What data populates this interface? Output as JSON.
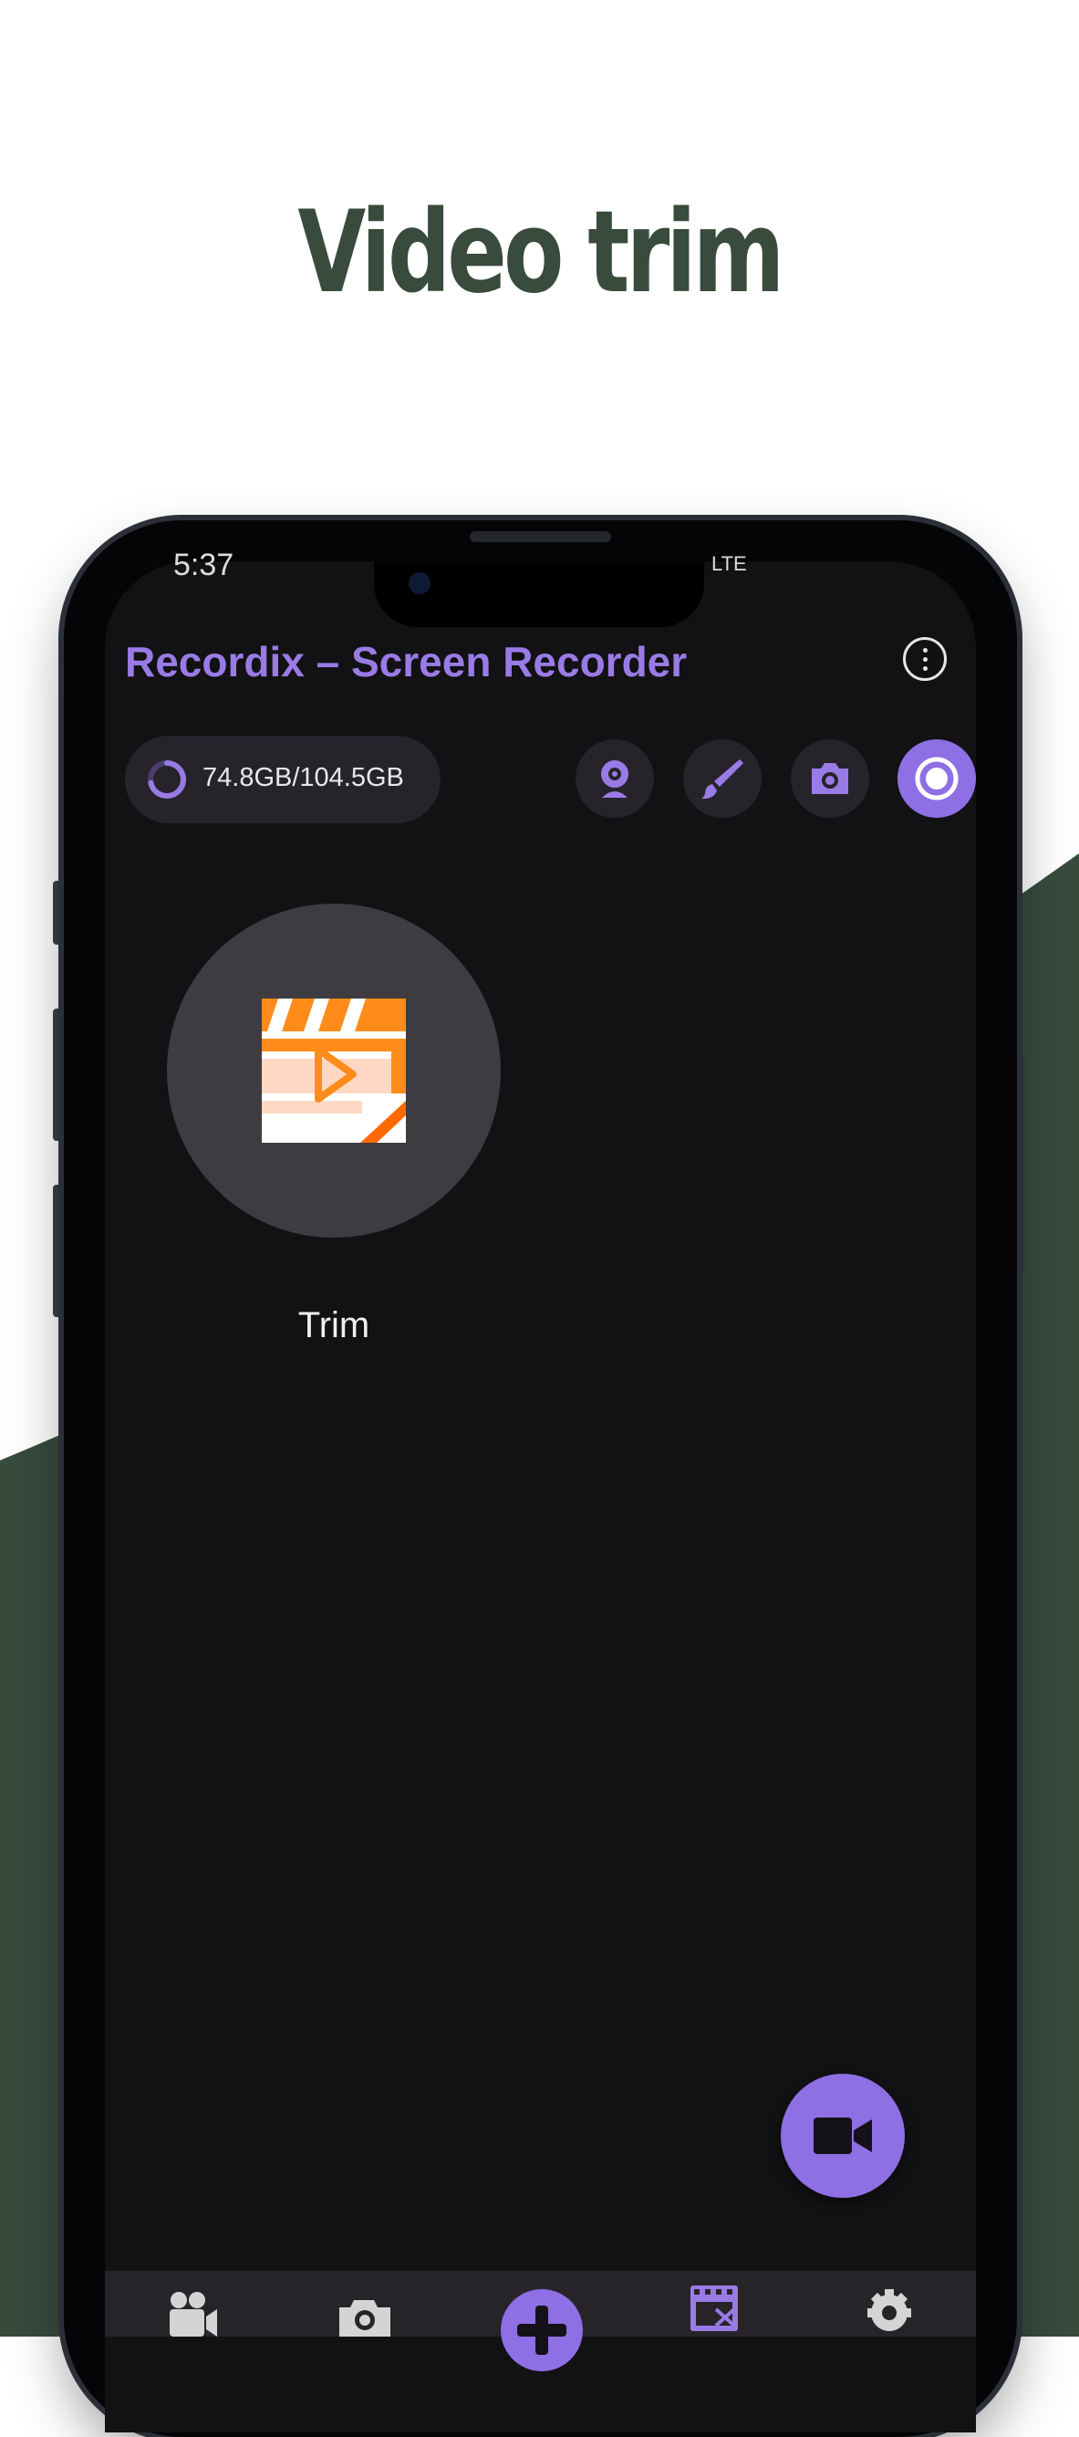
{
  "promo": {
    "headline": "Video trim",
    "accent_dark": "#384b3d"
  },
  "status_bar": {
    "time": "5:37",
    "icons_right": "LTE"
  },
  "app": {
    "title": "Recordix – Screen Recorder",
    "accent": "#8e6fe4",
    "menu_icon": "more-vert-icon"
  },
  "storage": {
    "text": "74.8GB/104.5GB",
    "used_fraction": 0.716
  },
  "toolbar": [
    {
      "name": "webcam-icon"
    },
    {
      "name": "brush-icon"
    },
    {
      "name": "camera-icon"
    },
    {
      "name": "record-icon"
    }
  ],
  "features": [
    {
      "label": "Trim",
      "icon": "video-trim-icon"
    }
  ],
  "fab": {
    "icon": "video-camera-icon"
  },
  "bottom_nav": [
    {
      "icon": "video-icon"
    },
    {
      "icon": "screenshot-icon"
    },
    {
      "icon": "add-icon"
    },
    {
      "icon": "video-editor-icon"
    },
    {
      "icon": "settings-icon"
    }
  ]
}
